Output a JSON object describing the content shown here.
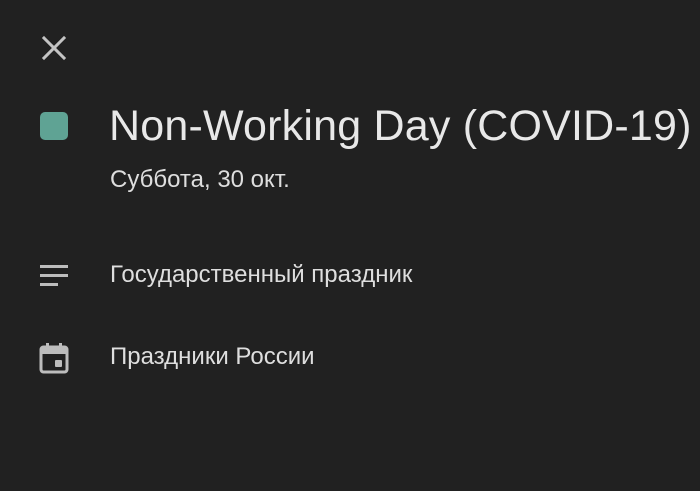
{
  "header": {
    "close_icon": "close-icon"
  },
  "event": {
    "color": "#5fa394",
    "title": "Non-Working Day (COVID-19)",
    "date": "Суббота, 30 окт."
  },
  "details": {
    "description_icon": "notes-icon",
    "description": "Государственный праздник",
    "calendar_icon": "calendar-icon",
    "calendar": "Праздники России"
  },
  "colors": {
    "background": "#212121",
    "text": "#e3e3e3",
    "icon": "#bdbdbd"
  }
}
